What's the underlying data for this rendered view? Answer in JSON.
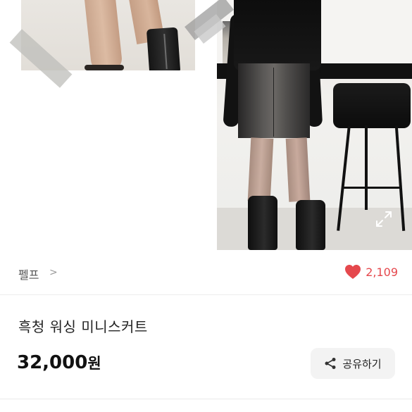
{
  "product": {
    "seller_name": "펠프",
    "seller_chevron": ">",
    "like_count": "2,109",
    "title": "흑청 워싱 미니스커트",
    "price_amount": "32,000",
    "price_unit": "원"
  },
  "actions": {
    "share_label": "공유하기"
  },
  "icons": {
    "heart": "heart-icon",
    "share": "share-icon",
    "expand": "expand-icon",
    "chevron": "chevron-right-icon"
  },
  "colors": {
    "heart": "#e5484d",
    "like_text": "#e5484d",
    "share_bg": "#f3f3f3"
  }
}
